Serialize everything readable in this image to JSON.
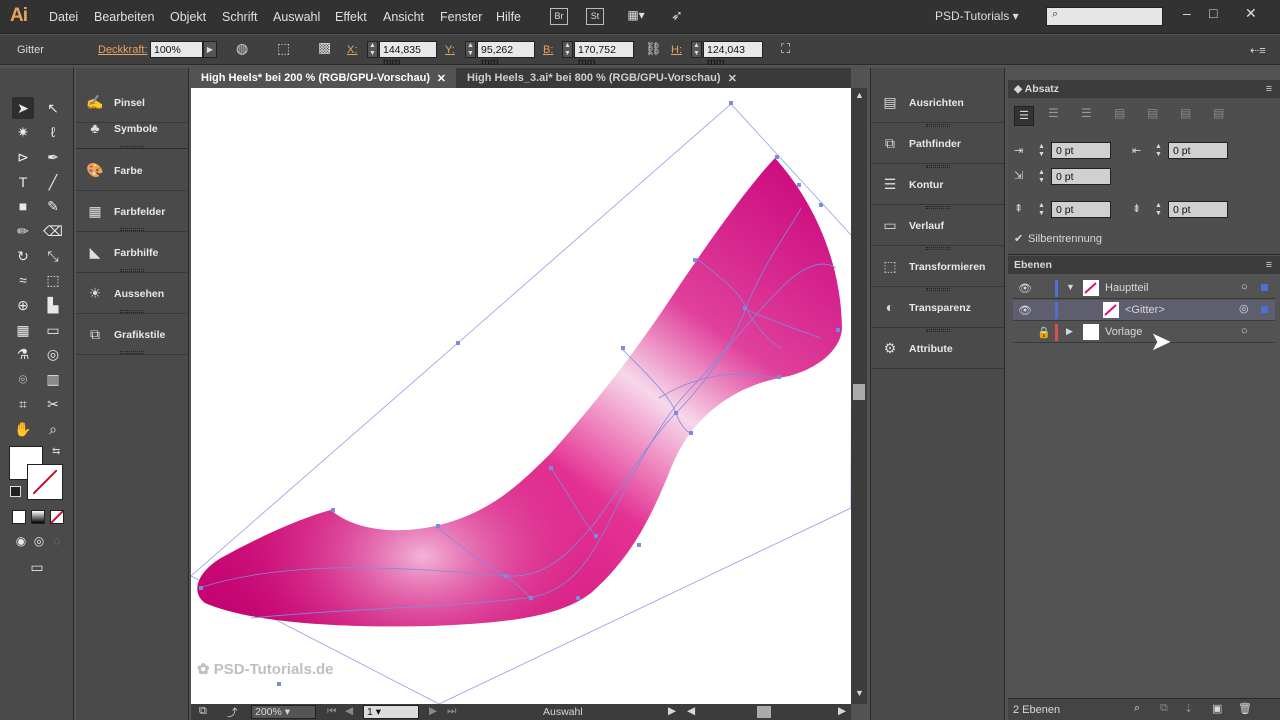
{
  "app": {
    "logo": "Ai",
    "workspace": "PSD-Tutorials",
    "search_placeholder": ""
  },
  "menu": [
    "Datei",
    "Bearbeiten",
    "Objekt",
    "Schrift",
    "Auswahl",
    "Effekt",
    "Ansicht",
    "Fenster",
    "Hilfe"
  ],
  "menu_icons": {
    "bridge": "Br",
    "stock": "St"
  },
  "control": {
    "object_type": "Gitter",
    "opacity_label": "Deckkraft:",
    "opacity_value": "100%",
    "x_label": "X:",
    "x_value": "144,835 mm",
    "y_label": "Y:",
    "y_value": "95,262 mm",
    "w_label": "B:",
    "w_value": "170,752 mm",
    "h_label": "H:",
    "h_value": "124,043 mm"
  },
  "tabs": [
    {
      "label": "High Heels* bei 200 % (RGB/GPU-Vorschau)",
      "active": true
    },
    {
      "label": "High Heels_3.ai* bei 800 % (RGB/GPU-Vorschau)",
      "active": false
    }
  ],
  "left_panels": [
    "Pinsel",
    "Symbole",
    "Farbe",
    "Farbfelder",
    "Farbhilfe",
    "Aussehen",
    "Grafikstile"
  ],
  "mid_panels": [
    "Ausrichten",
    "Pathfinder",
    "Kontur",
    "Verlauf",
    "Transformieren",
    "Transparenz",
    "Attribute"
  ],
  "absatz": {
    "title": "Absatz",
    "indent_left": "0 pt",
    "indent_right": "0 pt",
    "first_line": "0 pt",
    "space_before": "0 pt",
    "space_after": "0 pt",
    "hyphenation": "Silbentrennung"
  },
  "ebenen": {
    "title": "Ebenen",
    "layers": [
      {
        "name": "Hauptteil",
        "color": "#4f6fd8"
      },
      {
        "name": "<Gitter>",
        "color": "#4f6fd8"
      },
      {
        "name": "Vorlage",
        "color": "#d84f4f"
      }
    ],
    "count": "2 Ebenen"
  },
  "status": {
    "zoom": "200%",
    "page": "1",
    "tool": "Auswahl"
  },
  "watermark": "PSD-Tutorials.de",
  "colors": {
    "shoe": "#d4147e",
    "mesh_line": "#7b8ce0",
    "accent": "#e8a35f"
  }
}
